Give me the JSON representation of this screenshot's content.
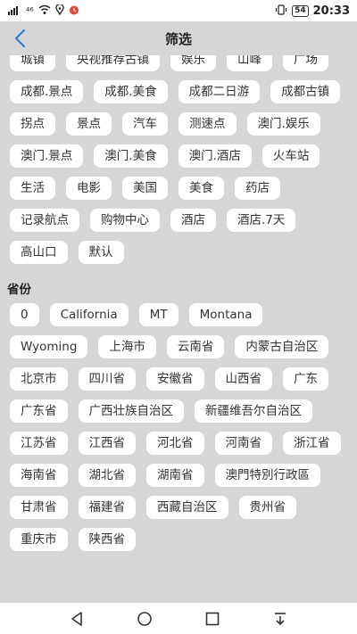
{
  "status_bar": {
    "left_signal": "⁴⁶",
    "wifi_icon": "wifi-icon",
    "battery": "54",
    "time": "20:33"
  },
  "header": {
    "title": "筛选"
  },
  "tags_top": [
    "城镇",
    "央视推荐古镇",
    "娱乐",
    "山峰",
    "广场",
    "成都.景点",
    "成都.美食",
    "成都二日游",
    "成都古镇",
    "拐点",
    "景点",
    "汽车",
    "测速点",
    "澳门.娱乐",
    "澳门.景点",
    "澳门.美食",
    "澳门.酒店",
    "火车站",
    "生活",
    "电影",
    "美国",
    "美食",
    "药店",
    "记录航点",
    "购物中心",
    "酒店",
    "酒店.7天",
    "高山口",
    "默认"
  ],
  "province_section": {
    "title": "省份",
    "tags": [
      "0",
      "California",
      "MT",
      "Montana",
      "Wyoming",
      "上海市",
      "云南省",
      "内蒙古自治区",
      "北京市",
      "四川省",
      "安徽省",
      "山西省",
      "广东",
      "广东省",
      "广西壮族自治区",
      "新疆维吾尔自治区",
      "江苏省",
      "江西省",
      "河北省",
      "河南省",
      "浙江省",
      "海南省",
      "湖北省",
      "湖南省",
      "澳門特別行政區",
      "甘肃省",
      "福建省",
      "西藏自治区",
      "贵州省",
      "重庆市",
      "陕西省"
    ]
  },
  "colors": {
    "background": "#d6d6d6",
    "tag_bg": "#ffffff",
    "accent": "#2f7fd8"
  }
}
